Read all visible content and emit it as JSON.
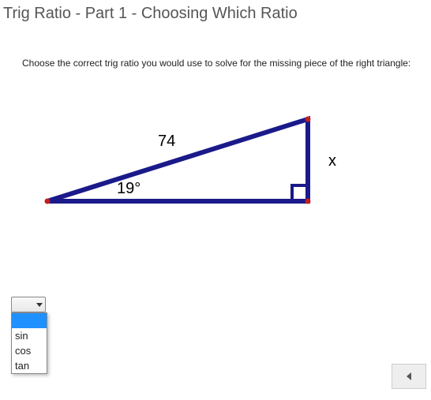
{
  "title": "Trig Ratio - Part 1 - Choosing Which Ratio",
  "question": "Choose the correct trig ratio you would use to solve for the missing piece of the right triangle:",
  "triangle": {
    "hypotenuse_label": "74",
    "angle_label": "19°",
    "opposite_label": "x"
  },
  "dropdown": {
    "selected": "",
    "options": [
      "",
      "sin",
      "cos",
      "tan"
    ],
    "highlighted_index": 0
  },
  "chart_data": {
    "type": "diagram",
    "description": "Right triangle with bottom-left acute angle 19°, hypotenuse 74, vertical right side labeled x (opposite the 19° angle), right angle at bottom-right.",
    "given_angle_deg": 19,
    "hypotenuse": 74,
    "unknown_side": "opposite",
    "unknown_label": "x",
    "correct_ratio": "sin"
  }
}
